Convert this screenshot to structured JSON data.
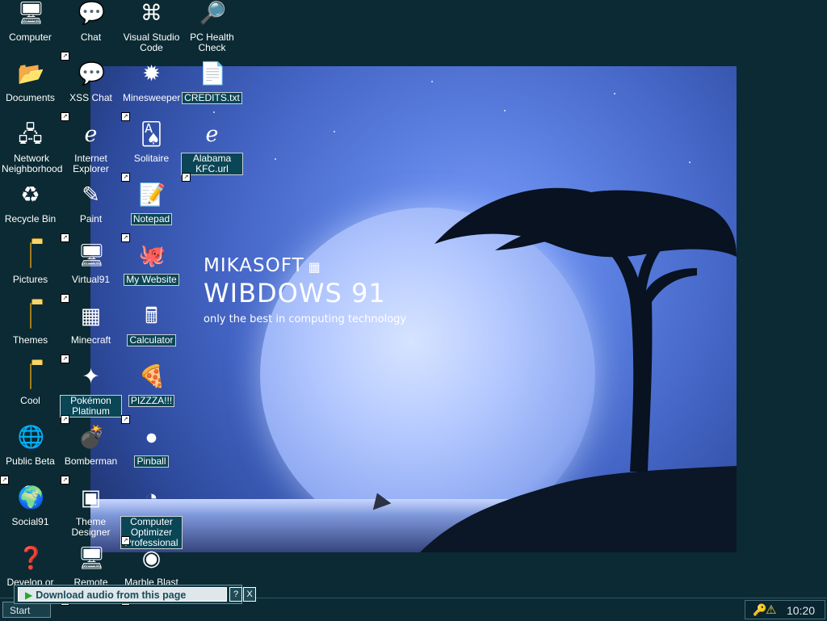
{
  "desktop": {
    "branding": {
      "maker": "MIKASOFT",
      "product": "WIBDOWS 91",
      "tagline": "only the best in computing technology"
    },
    "icons": [
      {
        "name": "computer",
        "label": "Computer",
        "glyph": "🖥"
      },
      {
        "name": "chat",
        "label": "Chat",
        "glyph": "💬"
      },
      {
        "name": "visual-studio-code",
        "label": "Visual Studio Code",
        "glyph": "⌘"
      },
      {
        "name": "pc-health-check",
        "label": "PC Health Check",
        "glyph": "🔎"
      },
      {
        "name": "documents",
        "label": "Documents",
        "glyph": "📂"
      },
      {
        "name": "xss-chat",
        "label": "XSS Chat",
        "glyph": "💬"
      },
      {
        "name": "minesweeper",
        "label": "Minesweeper",
        "glyph": "✹"
      },
      {
        "name": "credits-txt",
        "label": "CREDITS.txt",
        "glyph": "📄"
      },
      {
        "name": "network-neighborhood",
        "label": "Network Neighborhood",
        "glyph": "🖧"
      },
      {
        "name": "internet-explorer",
        "label": "Internet Explorer",
        "glyph": "ℯ"
      },
      {
        "name": "solitaire",
        "label": "Solitaire",
        "glyph": "🂡"
      },
      {
        "name": "alabama-kfc-url",
        "label": "Alabama KFC.url",
        "glyph": "ℯ"
      },
      {
        "name": "recycle-bin",
        "label": "Recycle Bin",
        "glyph": "♻"
      },
      {
        "name": "paint",
        "label": "Paint",
        "glyph": "✎"
      },
      {
        "name": "notepad",
        "label": "Notepad",
        "glyph": "📝"
      },
      {
        "name": "pictures",
        "label": "Pictures",
        "glyph": ""
      },
      {
        "name": "virtual91",
        "label": "Virtual91",
        "glyph": "🖥"
      },
      {
        "name": "my-website",
        "label": "My Website",
        "glyph": "🐙"
      },
      {
        "name": "themes",
        "label": "Themes",
        "glyph": ""
      },
      {
        "name": "minecraft",
        "label": "Minecraft",
        "glyph": "▦"
      },
      {
        "name": "calculator",
        "label": "Calculator",
        "glyph": "🖩"
      },
      {
        "name": "cool",
        "label": "Cool",
        "glyph": ""
      },
      {
        "name": "pokemon-platinum",
        "label": "Pokémon Platinum",
        "glyph": "✦"
      },
      {
        "name": "pizza",
        "label": "PIZZZA!!!",
        "glyph": "🍕"
      },
      {
        "name": "public-beta",
        "label": "Public Beta",
        "glyph": "🌐"
      },
      {
        "name": "bomberman",
        "label": "Bomberman",
        "glyph": "💣"
      },
      {
        "name": "pinball",
        "label": "Pinball",
        "glyph": "●"
      },
      {
        "name": "social91",
        "label": "Social91",
        "glyph": "🌍"
      },
      {
        "name": "theme-designer",
        "label": "Theme Designer",
        "glyph": "▣"
      },
      {
        "name": "computer-optimizer-professional",
        "label": "Computer Optimizer Professional",
        "glyph": "◔"
      },
      {
        "name": "develop-or",
        "label": "Develop or",
        "glyph": "❓"
      },
      {
        "name": "remote",
        "label": "Remote",
        "glyph": "🖥"
      },
      {
        "name": "marble-blast",
        "label": "Marble Blast",
        "glyph": "◉"
      }
    ]
  },
  "popup": {
    "download_label": "Download audio from this page",
    "help_label": "?",
    "close_label": "X"
  },
  "taskbar": {
    "start_label": "Start",
    "clock": "10:20"
  },
  "colors": {
    "desktop_bg": "#0b2a33",
    "selection": "#0b4656",
    "accent": "#20a92c"
  }
}
